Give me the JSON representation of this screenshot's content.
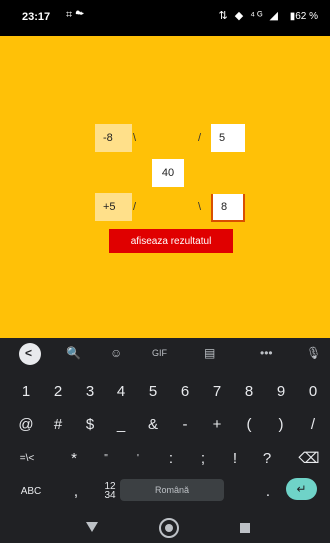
{
  "status_bar": {
    "time": "23:17",
    "left_icons": "⌗ ☁",
    "right_icons": "⇅ ◆ ⁴ᴳ ◢",
    "battery": "▮62 %"
  },
  "app": {
    "top_left": "-8",
    "top_right": "5",
    "center": "40",
    "bottom_left": "+5",
    "bottom_right": "8",
    "slash_tl": "\\",
    "slash_tr": "/",
    "slash_bl": "/",
    "slash_br": "\\",
    "result_button": "afiseaza rezultatul"
  },
  "keyboard": {
    "toolbar": {
      "back": "<",
      "search": "🔍",
      "sticker": "☺",
      "gif": "GIF",
      "clipboard": "▤",
      "more": "•••",
      "mic": "🎙"
    },
    "row1": [
      "1",
      "2",
      "3",
      "4",
      "5",
      "6",
      "7",
      "8",
      "9",
      "0"
    ],
    "row2": [
      "@",
      "#",
      "$",
      "_",
      "&",
      "-",
      "+",
      "(",
      ")",
      "/"
    ],
    "row3": [
      "=\\<",
      "*",
      "\"",
      "'",
      ":",
      ";",
      "!",
      "?",
      "⌫"
    ],
    "row4": {
      "abc": "ABC",
      "comma": ",",
      "numpad": "12\n34",
      "space": "Română",
      "period": ".",
      "enter": "↵"
    }
  },
  "colors": {
    "app_background": "#ffc107",
    "button": "#e00000",
    "keyboard_background": "#202124",
    "enter_key": "#6fd3c8"
  }
}
